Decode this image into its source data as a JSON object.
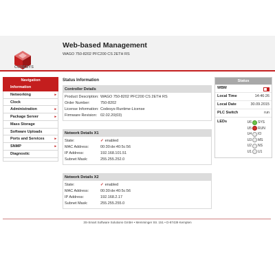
{
  "header": {
    "logo_text": "CODESYS",
    "title": "Web-based Management",
    "device": "WAGO 750-8202 PFC200 CS 2ETH RS"
  },
  "nav": {
    "title": "Navigation",
    "items": [
      {
        "label": "Information",
        "active": true,
        "arrow": false
      },
      {
        "label": "Networking",
        "active": false,
        "arrow": true
      },
      {
        "label": "Clock",
        "active": false,
        "arrow": false
      },
      {
        "label": "Administration",
        "active": false,
        "arrow": true
      },
      {
        "label": "Package Server",
        "active": false,
        "arrow": true
      },
      {
        "label": "Mass Storage",
        "active": false,
        "arrow": false
      },
      {
        "label": "Software Uploads",
        "active": false,
        "arrow": false
      },
      {
        "label": "Ports and Services",
        "active": false,
        "arrow": true
      },
      {
        "label": "SNMP",
        "active": false,
        "arrow": true
      },
      {
        "label": "Diagnostic",
        "active": false,
        "arrow": false
      }
    ]
  },
  "main": {
    "title": "Status Information",
    "controller": {
      "title": "Controller Details",
      "rows": [
        {
          "label": "Product Description:",
          "value": "WAGO 750-8202 PFC200 CS 2ETH RS"
        },
        {
          "label": "Order Number:",
          "value": "750-8202"
        },
        {
          "label": "License Information:",
          "value": "Codesys-Runtime-License"
        },
        {
          "label": "Firmware Revision:",
          "value": "02.02.20(03)"
        }
      ]
    },
    "x1": {
      "title": "Network Details X1",
      "state_label": "State:",
      "state_value": "enabled",
      "rows": [
        {
          "label": "MAC Address:",
          "value": "00:30:de:40:5c:56"
        },
        {
          "label": "IP Address:",
          "value": "192.168.101.51"
        },
        {
          "label": "Subnet Mask:",
          "value": "255.255.252.0"
        }
      ]
    },
    "x2": {
      "title": "Network Details X2",
      "state_label": "State:",
      "state_value": "enabled",
      "rows": [
        {
          "label": "MAC Address:",
          "value": "00:30:de:40:5c:56"
        },
        {
          "label": "IP Address:",
          "value": "192.168.2.17"
        },
        {
          "label": "Subnet Mask:",
          "value": "255.255.255.0"
        }
      ]
    }
  },
  "status": {
    "title": "Status",
    "wbm_label": "WBM",
    "local_time_label": "Local Time",
    "local_time": "14:46:26",
    "local_date_label": "Local Date",
    "local_date": "30.09.2015",
    "plc_switch_label": "PLC Switch",
    "plc_switch": "run",
    "leds_label": "LEDs",
    "leds": [
      {
        "id": "U6",
        "name": "SYS",
        "color": "green"
      },
      {
        "id": "U5",
        "name": "RUN",
        "color": "red"
      },
      {
        "id": "U4",
        "name": "IO",
        "color": "off"
      },
      {
        "id": "U3",
        "name": "MS",
        "color": "off"
      },
      {
        "id": "U2",
        "name": "NS",
        "color": "off"
      },
      {
        "id": "U1",
        "name": "U1",
        "color": "off"
      }
    ],
    "colors": {
      "green": "#6cc24a",
      "red": "#d0302a",
      "off": "#eeeeee"
    }
  },
  "footer": {
    "text": "3S-Smart Software Solutions GmbH • Memminger Str. 151 • D-87439 Kempten"
  }
}
